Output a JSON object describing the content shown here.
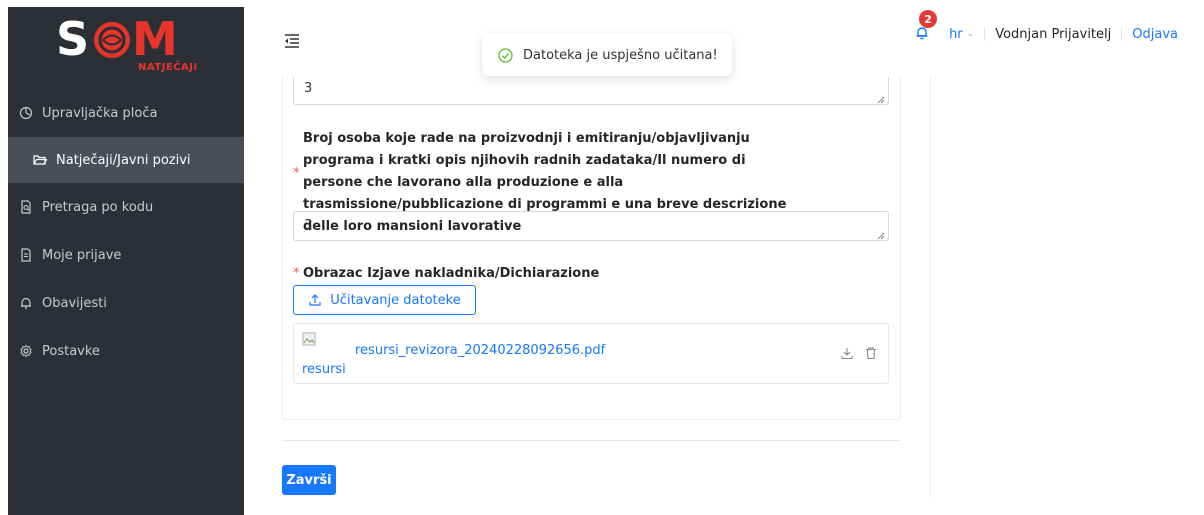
{
  "app": {
    "logo_main": "S",
    "logo_m": "M",
    "logo_sub": "NATJEČAJI"
  },
  "sidebar": {
    "items": [
      {
        "label": "Upravljačka ploča",
        "icon": "dashboard-icon",
        "active": false
      },
      {
        "label": "Natječaji/Javni pozivi",
        "icon": "folder-open-icon",
        "active": true
      },
      {
        "label": "Pretraga po kodu",
        "icon": "file-search-icon",
        "active": false
      },
      {
        "label": "Moje prijave",
        "icon": "file-icon",
        "active": false
      },
      {
        "label": "Obavijesti",
        "icon": "bell-icon",
        "active": false
      },
      {
        "label": "Postavke",
        "icon": "gear-icon",
        "active": false
      }
    ]
  },
  "header": {
    "notification_count": "2",
    "language": "hr",
    "username": "Vodnjan Prijavitelj",
    "logout_label": "Odjava"
  },
  "toast": {
    "message": "Datoteka je uspješno učitana!"
  },
  "form": {
    "prev_answer": "3",
    "question_label": "Broj osoba koje rade na proizvodnji i emitiranju/objavljivanju programa i kratki opis njihovih radnih zadataka/Il numero di persone che lavorano alla produzione e alla trasmissione/pubblicazione di programmi e una breve descrizione delle loro mansioni lavorative",
    "question_answer": "3",
    "required_mark": "*",
    "upload_field_label": "Obrazac Izjave nakladnika/Dichiarazione",
    "upload_button_label": "Učitavanje datoteke",
    "file": {
      "alt_text": "resursi",
      "name": "resursi_revizora_20240228092656.pdf"
    },
    "finish_label": "Završi"
  },
  "colors": {
    "accent": "#1677ff",
    "sidebar_bg": "#2c2f36",
    "sidebar_active": "#4a4f57",
    "required": "#ff4d4f",
    "badge": "#e53935",
    "logo_red": "#e8352b"
  }
}
